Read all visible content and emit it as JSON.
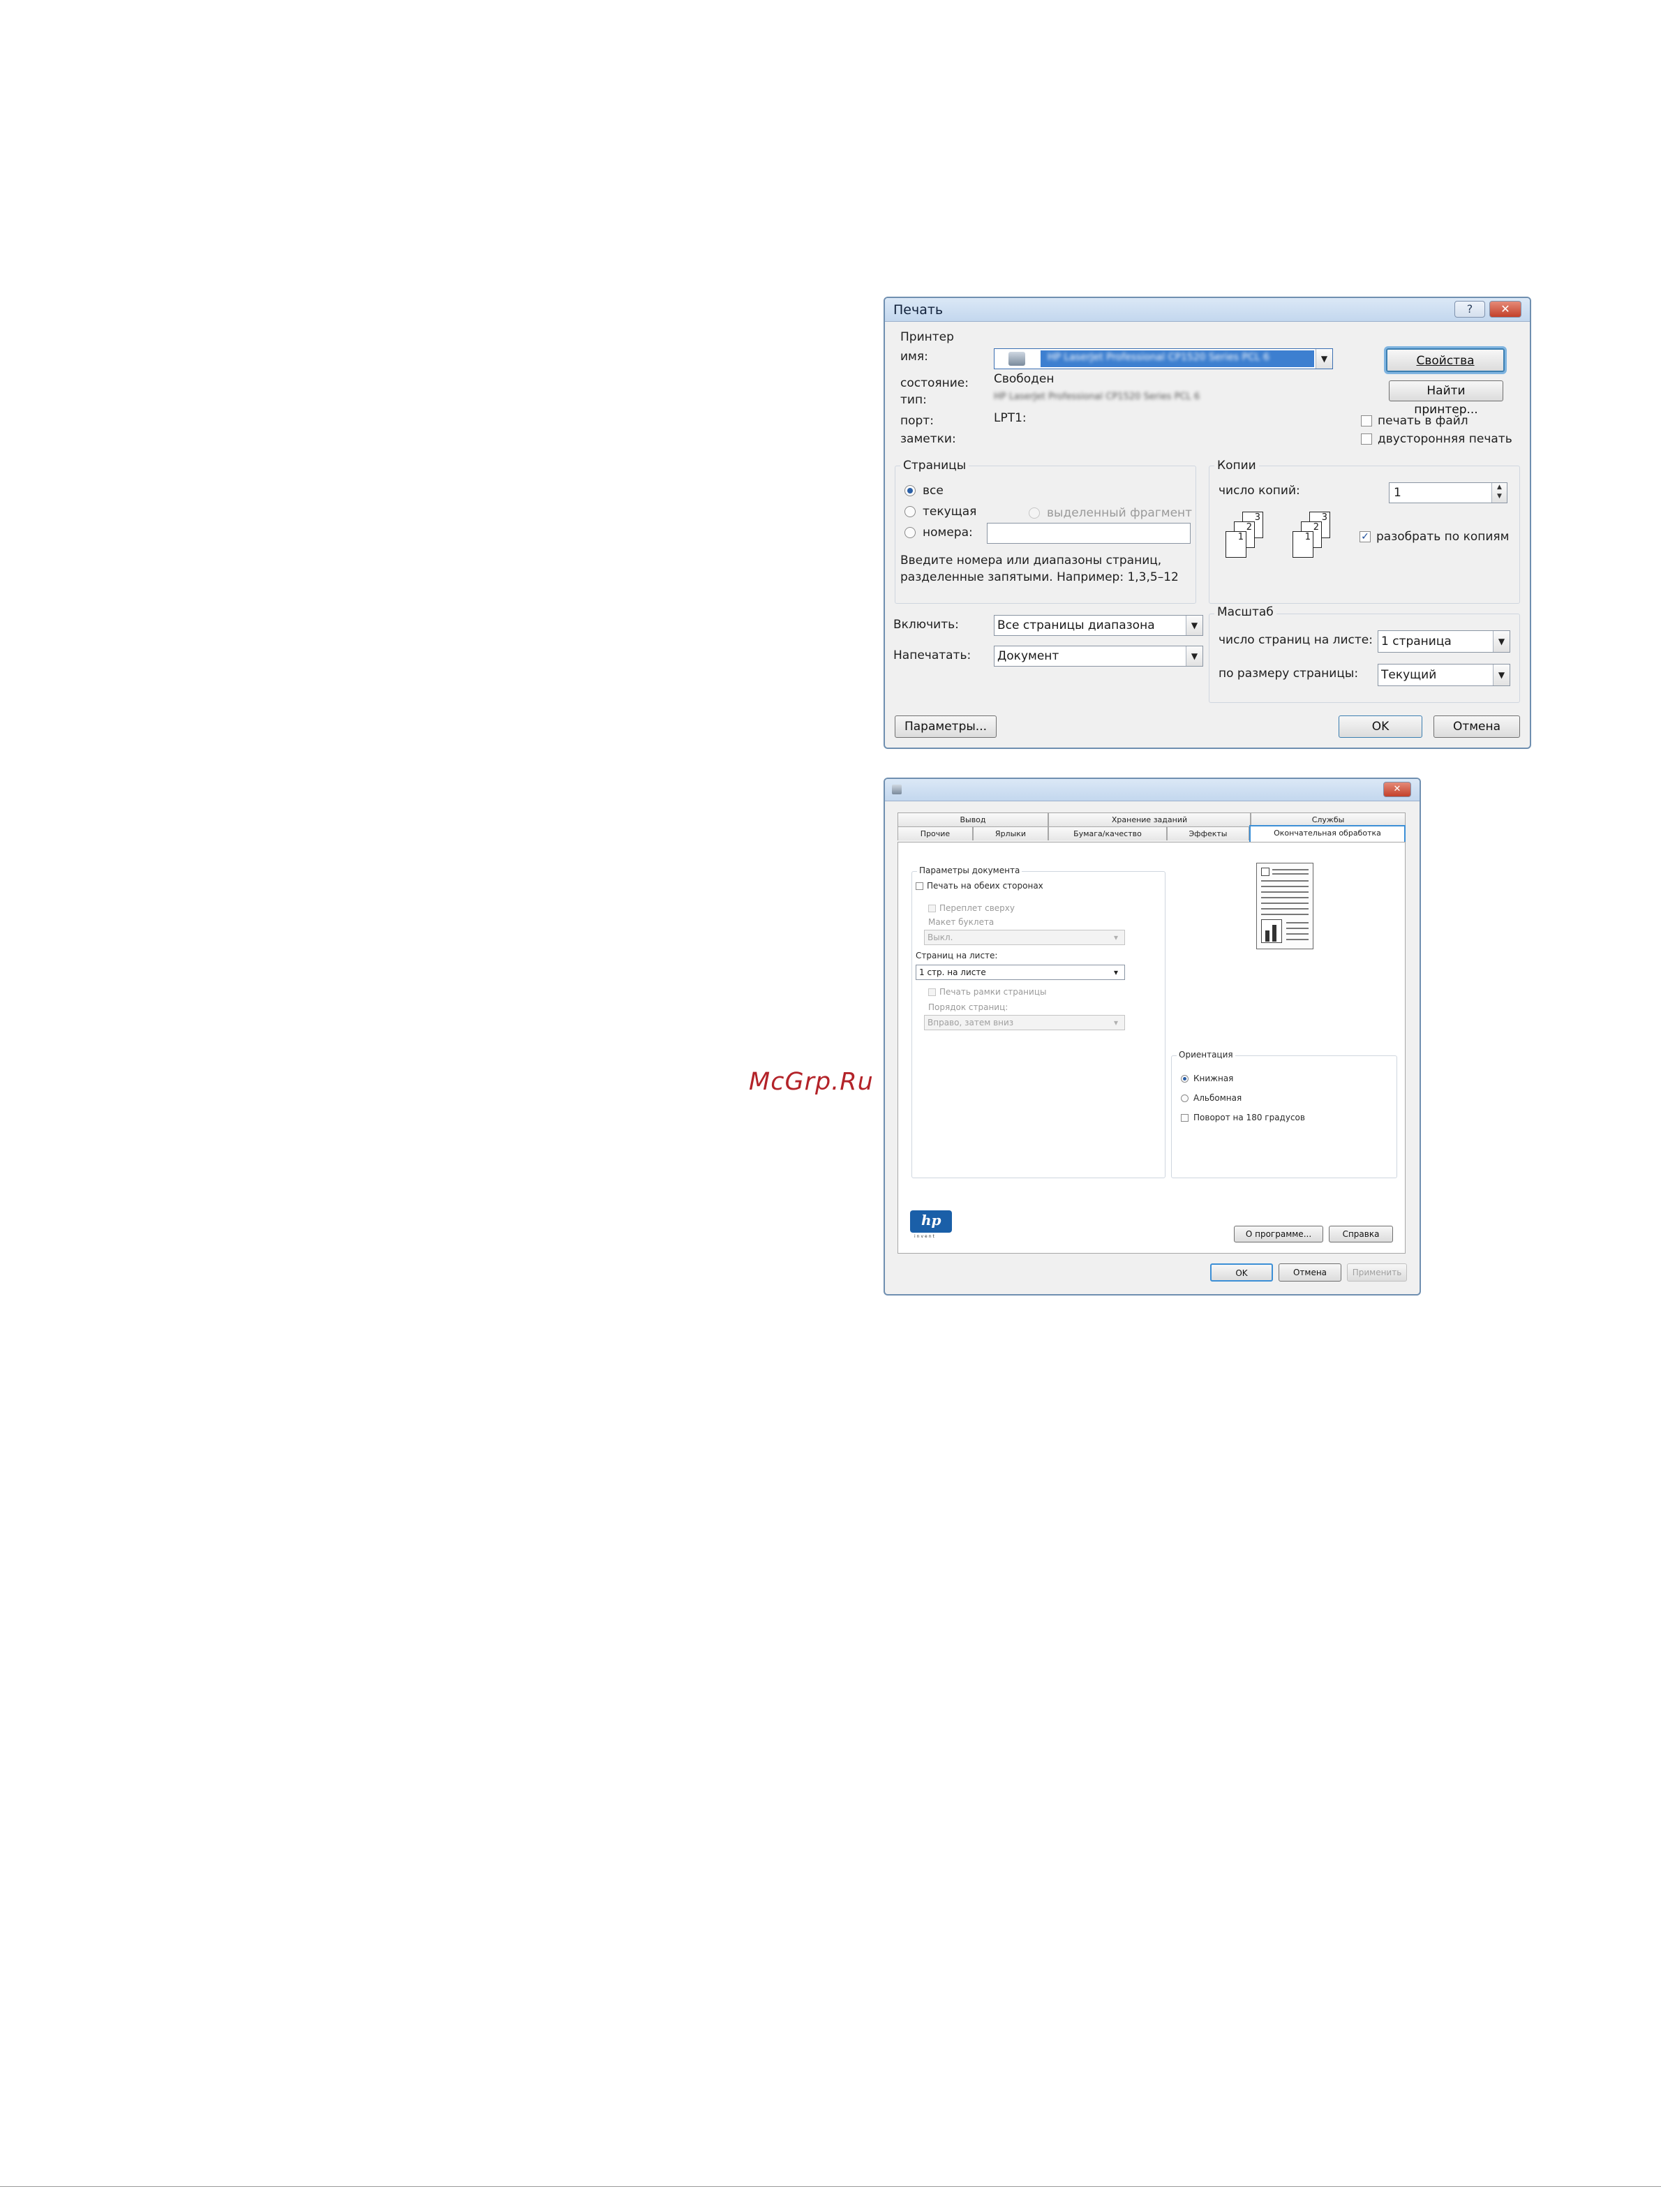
{
  "print_dialog": {
    "title": "Печать",
    "printer_group": "Принтер",
    "name_label": "имя:",
    "printer_name": "HP LaserJet Professional CP1520 Series PCL 6",
    "properties_button": "Свойства",
    "status_label": "состояние:",
    "status_value": "Свободен",
    "type_label": "тип:",
    "type_value": "HP LaserJet Professional CP1520 Series PCL 6",
    "port_label": "порт:",
    "port_value": "LPT1:",
    "notes_label": "заметки:",
    "find_printer_button": "Найти принтер...",
    "print_to_file": "печать в файл",
    "duplex": "двусторонняя печать",
    "pages_group": "Страницы",
    "all": "все",
    "current": "текущая",
    "selection": "выделенный фрагмент",
    "pages": "номера:",
    "pages_hint_1": "Введите номера или диапазоны страниц,",
    "pages_hint_2": "разделенные запятыми. Например: 1,3,5–12",
    "copies_group": "Копии",
    "copies_label": "число копий:",
    "copies_value": "1",
    "collate": "разобрать по копиям",
    "include_label": "Включить:",
    "include_value": "Все страницы диапазона",
    "print_what_label": "Напечатать:",
    "print_what_value": "Документ",
    "zoom_group": "Масштаб",
    "pages_per_sheet_label": "число страниц на листе:",
    "pages_per_sheet_value": "1 страница",
    "scale_label": "по размеру страницы:",
    "scale_value": "Текущий",
    "options_button": "Параметры...",
    "ok_button": "OK",
    "cancel_button": "Отмена",
    "help_glyph": "?",
    "close_glyph": "✕"
  },
  "properties_dialog": {
    "close_glyph": "✕",
    "tabs_top": [
      "Вывод",
      "Хранение заданий",
      "Службы"
    ],
    "tabs_bottom": [
      "Прочие",
      "Ярлыки",
      "Бумага/качество",
      "Эффекты",
      "Окончательная обработка"
    ],
    "doc_options_group": "Параметры документа",
    "print_both_sides": "Печать на обеих сторонах",
    "flip_pages_up": "Переплет сверху",
    "booklet_layout": "Макет буклета",
    "booklet_value": "Выкл.",
    "pages_per_sheet_label": "Страниц на листе:",
    "pages_per_sheet_value": "1 стр. на листе",
    "print_page_borders": "Печать рамки страницы",
    "page_order_label": "Порядок страниц:",
    "page_order_value": "Вправо, затем вниз",
    "orientation_group": "Ориентация",
    "portrait": "Книжная",
    "landscape": "Альбомная",
    "rotate_180": "Поворот на 180 градусов",
    "about_button": "О программе...",
    "help_button": "Справка",
    "ok_button": "OK",
    "cancel_button": "Отмена",
    "apply_button": "Применить",
    "hp_logo_text": "hp",
    "hp_logo_subtext": "invent"
  },
  "watermark": "McGrp.Ru"
}
